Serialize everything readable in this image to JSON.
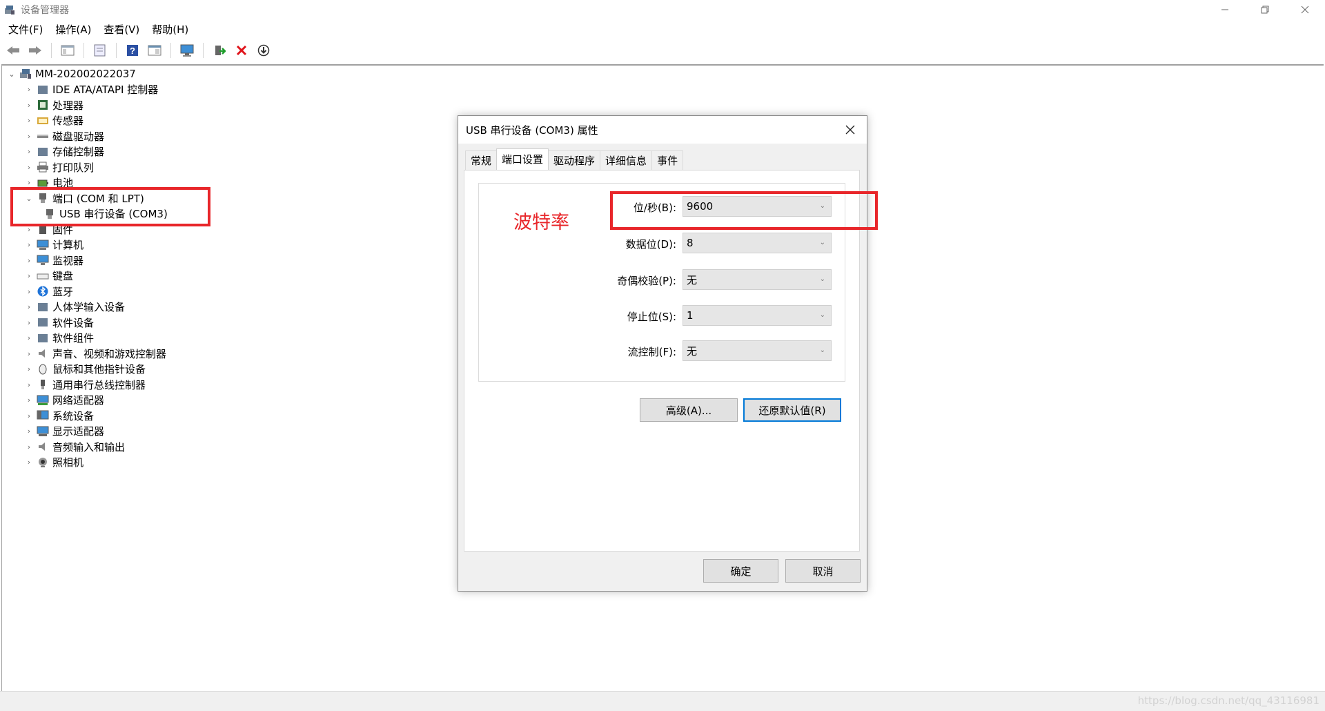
{
  "window": {
    "title": "设备管理器",
    "buttons": [
      "minimize",
      "maximize",
      "close"
    ]
  },
  "menubar": {
    "items": [
      "文件(F)",
      "操作(A)",
      "查看(V)",
      "帮助(H)"
    ]
  },
  "toolbar": {
    "icons": [
      "back-arrow-icon",
      "forward-arrow-icon",
      "show-hide-tree-icon",
      "properties-icon",
      "help-icon",
      "view-icon",
      "monitor-icon",
      "update-driver-icon",
      "uninstall-x-icon",
      "download-circle-icon"
    ]
  },
  "tree": {
    "root": "MM-202002022037",
    "categories": [
      {
        "label": "IDE ATA/ATAPI 控制器",
        "icon": "ide-controller-icon"
      },
      {
        "label": "处理器",
        "icon": "processor-icon"
      },
      {
        "label": "传感器",
        "icon": "sensor-icon"
      },
      {
        "label": "磁盘驱动器",
        "icon": "disk-drive-icon"
      },
      {
        "label": "存储控制器",
        "icon": "storage-controller-icon"
      },
      {
        "label": "打印队列",
        "icon": "printer-icon"
      },
      {
        "label": "电池",
        "icon": "battery-icon"
      },
      {
        "label": "端口 (COM 和 LPT)",
        "icon": "port-icon",
        "expanded": true,
        "children": [
          "USB 串行设备 (COM3)"
        ]
      },
      {
        "label": "固件",
        "icon": "firmware-icon"
      },
      {
        "label": "计算机",
        "icon": "computer-icon"
      },
      {
        "label": "监视器",
        "icon": "monitor-icon"
      },
      {
        "label": "键盘",
        "icon": "keyboard-icon"
      },
      {
        "label": "蓝牙",
        "icon": "bluetooth-icon"
      },
      {
        "label": "人体学输入设备",
        "icon": "hid-icon"
      },
      {
        "label": "软件设备",
        "icon": "software-device-icon"
      },
      {
        "label": "软件组件",
        "icon": "software-component-icon"
      },
      {
        "label": "声音、视频和游戏控制器",
        "icon": "sound-icon"
      },
      {
        "label": "鼠标和其他指针设备",
        "icon": "mouse-icon"
      },
      {
        "label": "通用串行总线控制器",
        "icon": "usb-icon"
      },
      {
        "label": "网络适配器",
        "icon": "network-adapter-icon"
      },
      {
        "label": "系统设备",
        "icon": "system-device-icon"
      },
      {
        "label": "显示适配器",
        "icon": "display-adapter-icon"
      },
      {
        "label": "音频输入和输出",
        "icon": "audio-io-icon"
      },
      {
        "label": "照相机",
        "icon": "camera-icon"
      }
    ]
  },
  "dialog": {
    "title": "USB 串行设备 (COM3) 属性",
    "tabs": [
      "常规",
      "端口设置",
      "驱动程序",
      "详细信息",
      "事件"
    ],
    "active_tab": "端口设置",
    "annotation": "波特率",
    "fields": [
      {
        "label": "位/秒(B):",
        "value": "9600"
      },
      {
        "label": "数据位(D):",
        "value": "8"
      },
      {
        "label": "奇偶校验(P):",
        "value": "无"
      },
      {
        "label": "停止位(S):",
        "value": "1"
      },
      {
        "label": "流控制(F):",
        "value": "无"
      }
    ],
    "advanced_button": "高级(A)...",
    "restore_button": "还原默认值(R)",
    "ok_button": "确定",
    "cancel_button": "取消"
  },
  "watermark": "https://blog.csdn.net/qq_43116981",
  "colors": {
    "annotation_red": "#e8262a",
    "default_button_border": "#0078d7"
  }
}
